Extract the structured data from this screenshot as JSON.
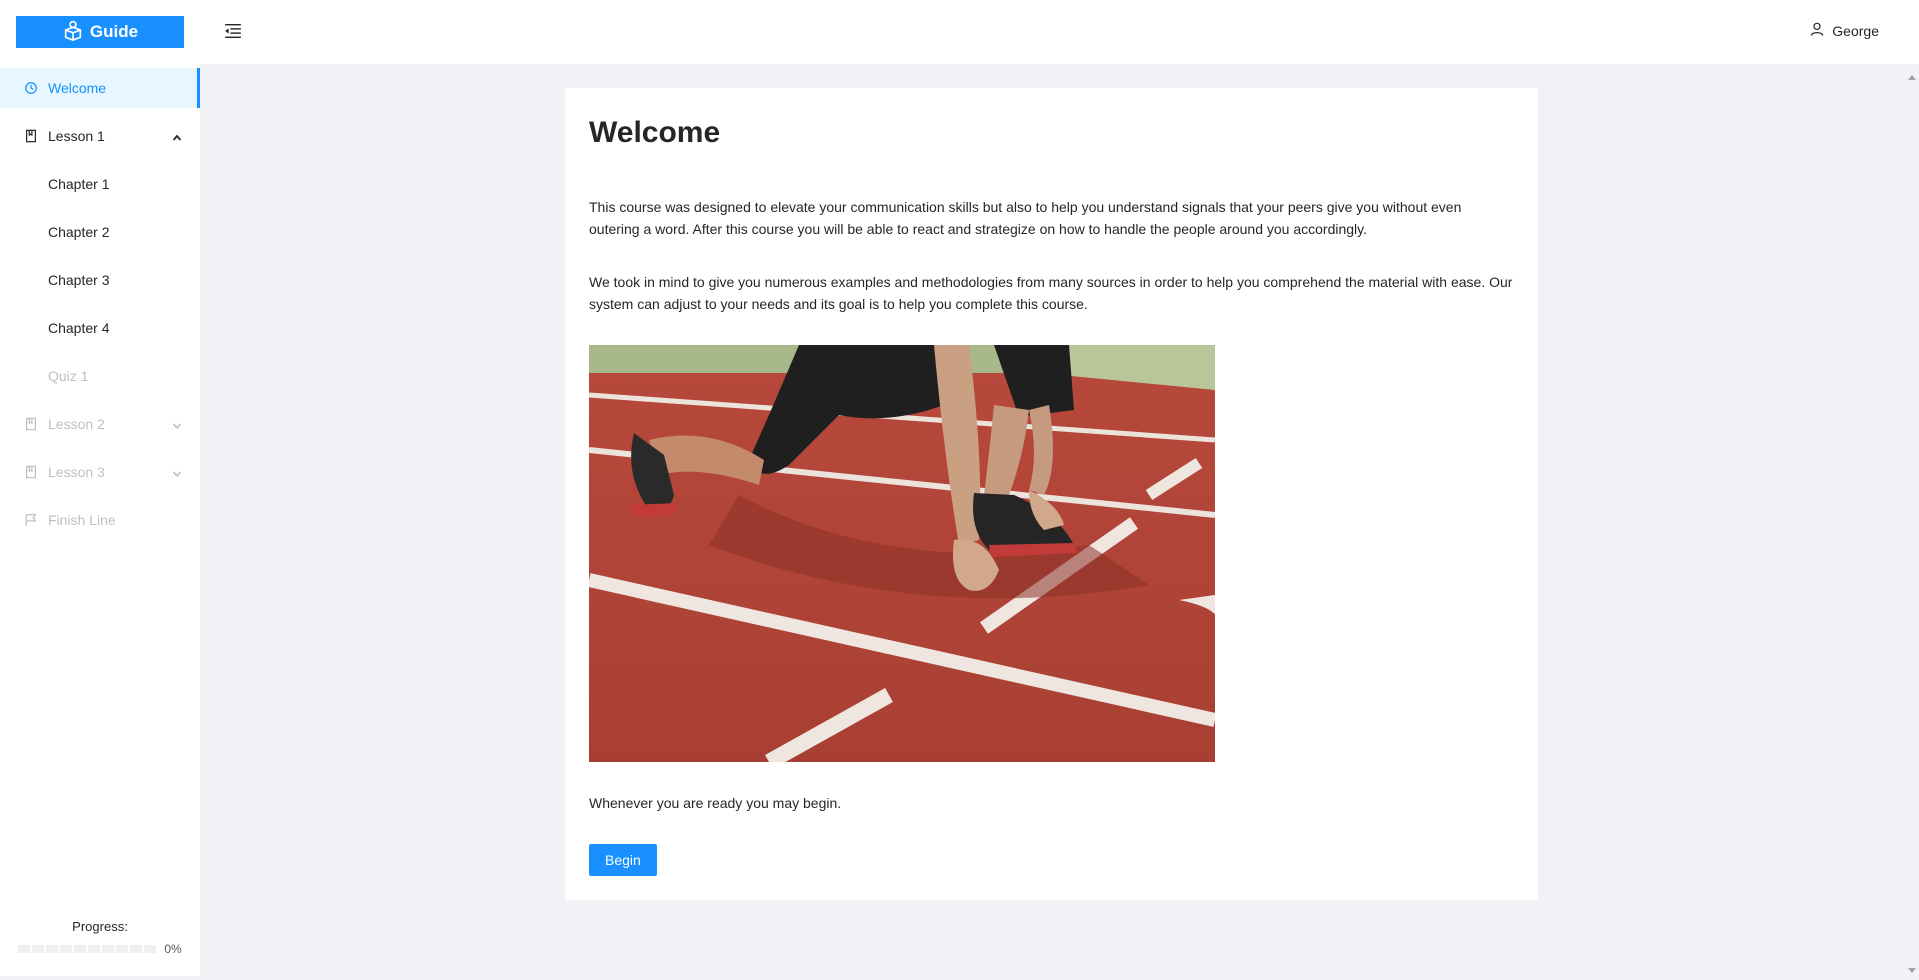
{
  "header": {
    "logo_text": "Guide",
    "user_name": "George"
  },
  "sidebar": {
    "items": [
      {
        "label": "Welcome",
        "icon": "clock-icon",
        "state": "active"
      },
      {
        "label": "Lesson 1",
        "icon": "book-icon",
        "state": "expanded"
      },
      {
        "label": "Chapter 1",
        "state": "normal"
      },
      {
        "label": "Chapter 2",
        "state": "normal"
      },
      {
        "label": "Chapter 3",
        "state": "normal"
      },
      {
        "label": "Chapter 4",
        "state": "normal"
      },
      {
        "label": "Quiz 1",
        "state": "disabled"
      },
      {
        "label": "Lesson 2",
        "icon": "book-icon",
        "state": "disabled"
      },
      {
        "label": "Lesson 3",
        "icon": "book-icon",
        "state": "disabled"
      },
      {
        "label": "Finish Line",
        "icon": "flag-icon",
        "state": "disabled"
      }
    ],
    "progress_label": "Progress:",
    "progress_text": "0%",
    "progress_value": 0
  },
  "content": {
    "title": "Welcome",
    "paragraph_1": "This course was designed to elevate your communication skills but also to help you understand signals that your peers give you without even outering a word. After this course you will be able to react and strategize on how to handle the people around you accordingly.",
    "paragraph_2": "We took in mind to give you numerous examples and methodologies from many sources in order to help you comprehend the material with ease. Our system can adjust to your needs and its goal is to help you complete this course.",
    "paragraph_3": "Whenever you are ready you may begin.",
    "begin_label": "Begin"
  },
  "colors": {
    "accent": "#1890ff",
    "background": "#f0f2f5",
    "track": "#b5453a"
  }
}
